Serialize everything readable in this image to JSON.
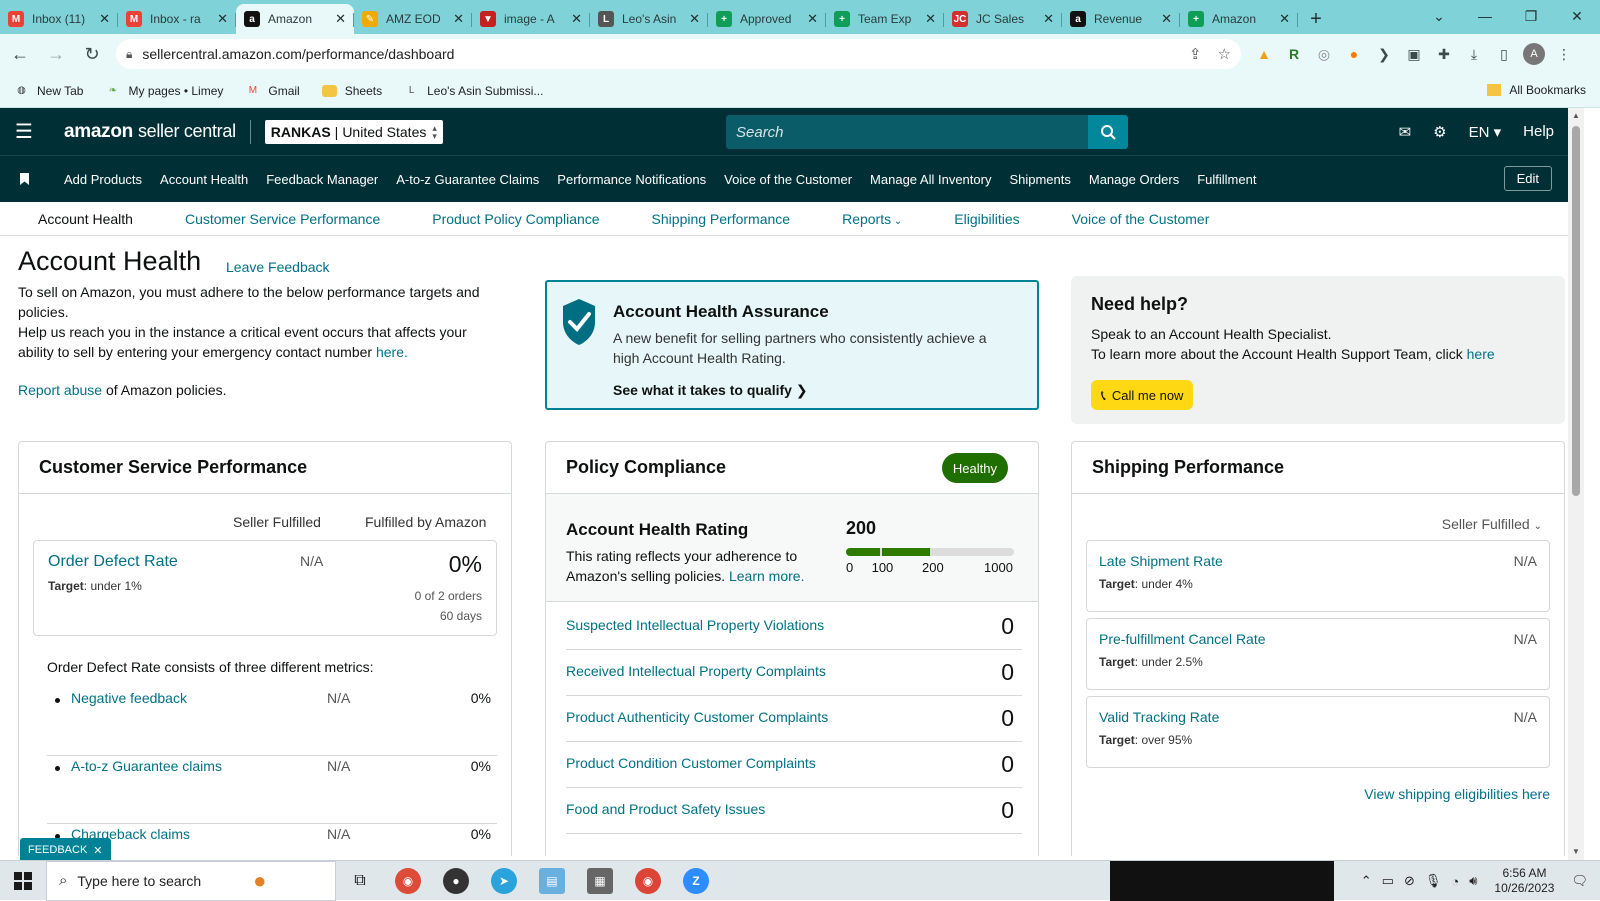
{
  "browser": {
    "tabs": [
      {
        "title": "Inbox (11)",
        "icon": "gmail-icon",
        "color": "#ea4335",
        "glyph": "M"
      },
      {
        "title": "Inbox - ra",
        "icon": "gmail-icon",
        "color": "#ea4335",
        "glyph": "M"
      },
      {
        "title": "Amazon",
        "icon": "amazon-icon",
        "color": "#111111",
        "glyph": "a"
      },
      {
        "title": "AMZ EOD",
        "icon": "pencil-icon",
        "color": "#f2a900",
        "glyph": "✎"
      },
      {
        "title": "image - A",
        "icon": "gmail-icon",
        "color": "#c5221f",
        "glyph": "▼"
      },
      {
        "title": "Leo's Asin",
        "icon": "form-icon",
        "color": "#555555",
        "glyph": "L"
      },
      {
        "title": "Approved",
        "icon": "sheets-icon",
        "color": "#0f9d58",
        "glyph": "+"
      },
      {
        "title": "Team Exp",
        "icon": "sheets-icon",
        "color": "#0f9d58",
        "glyph": "+"
      },
      {
        "title": "JC Sales",
        "icon": "jc-icon",
        "color": "#d32f2f",
        "glyph": "JC"
      },
      {
        "title": "Revenue",
        "icon": "amazon-icon",
        "color": "#111111",
        "glyph": "a"
      },
      {
        "title": "Amazon",
        "icon": "sheets-icon",
        "color": "#0f9d58",
        "glyph": "+"
      }
    ],
    "active_tab": 2,
    "url": "sellercentral.amazon.com/performance/dashboard",
    "bookmarks": [
      {
        "label": "New Tab",
        "icon": "globe-icon"
      },
      {
        "label": "My pages • Limey",
        "icon": "leaf-icon"
      },
      {
        "label": "Gmail",
        "icon": "gmail-icon"
      },
      {
        "label": "Sheets",
        "icon": "folder-icon"
      },
      {
        "label": "Leo's Asin Submissi...",
        "icon": "form-icon"
      }
    ],
    "all_bookmarks": "All Bookmarks",
    "profile_initial": "A"
  },
  "header": {
    "logo_amazon": "amazon",
    "logo_sc": "seller central",
    "store_name": "RANKAS",
    "store_region": "United States",
    "search_placeholder": "Search",
    "language": "EN",
    "help": "Help"
  },
  "nav": {
    "items": [
      "Add Products",
      "Account Health",
      "Feedback Manager",
      "A-to-z Guarantee Claims",
      "Performance Notifications",
      "Voice of the Customer",
      "Manage All Inventory",
      "Shipments",
      "Manage Orders",
      "Fulfillment"
    ],
    "edit": "Edit"
  },
  "subnav": {
    "items": [
      "Account Health",
      "Customer Service Performance",
      "Product Policy Compliance",
      "Shipping Performance",
      "Reports",
      "Eligibilities",
      "Voice of the Customer"
    ]
  },
  "page": {
    "title": "Account Health",
    "leave_feedback": "Leave Feedback",
    "intro1": "To sell on Amazon, you must adhere to the below performance targets and policies.",
    "intro2": "Help us reach you in the instance a critical event occurs that affects your ability to sell by entering your emergency contact number",
    "intro2_link": "here.",
    "report_link": "Report abuse",
    "report_rest": "of Amazon policies."
  },
  "aha": {
    "title": "Account Health Assurance",
    "desc": "A new benefit for selling partners who consistently achieve a high Account Health Rating.",
    "cta": "See what it takes to qualify"
  },
  "help_box": {
    "title": "Need help?",
    "line1": "Speak to an Account Health Specialist.",
    "line2": "To learn more about the Account Health Support Team, click",
    "line2_link": "here",
    "button": "Call me now"
  },
  "csp": {
    "title": "Customer Service Performance",
    "col_sf": "Seller Fulfilled",
    "col_fba": "Fulfilled by Amazon",
    "odr_label": "Order Defect Rate",
    "odr_target_label": "Target",
    "odr_target": ": under 1%",
    "odr_sf": "N/A",
    "odr_fba": "0%",
    "odr_orders": "0 of 2 orders",
    "odr_days": "60 days",
    "desc": "Order Defect Rate consists of three different metrics:",
    "metrics": [
      {
        "label": "Negative feedback",
        "sf": "N/A",
        "fba": "0%"
      },
      {
        "label": "A-to-z Guarantee claims",
        "sf": "N/A",
        "fba": "0%"
      },
      {
        "label": "Chargeback claims",
        "sf": "N/A",
        "fba": "0%"
      }
    ]
  },
  "policy": {
    "title": "Policy Compliance",
    "status": "Healthy",
    "ahr_title": "Account Health Rating",
    "ahr_desc": "This rating reflects your adherence to Amazon's selling policies.",
    "ahr_link": "Learn more.",
    "ahr_score": "200",
    "ahr_score_value": 200,
    "ahr_ticks": [
      "0",
      "100",
      "200",
      "1000"
    ],
    "rows": [
      {
        "label": "Suspected Intellectual Property Violations",
        "value": "0"
      },
      {
        "label": "Received Intellectual Property Complaints",
        "value": "0"
      },
      {
        "label": "Product Authenticity Customer Complaints",
        "value": "0"
      },
      {
        "label": "Product Condition Customer Complaints",
        "value": "0"
      },
      {
        "label": "Food and Product Safety Issues",
        "value": "0"
      }
    ]
  },
  "shipping": {
    "title": "Shipping Performance",
    "filter": "Seller Fulfilled",
    "target_label": "Target",
    "metrics": [
      {
        "label": "Late Shipment Rate",
        "target": ": under 4%",
        "value": "N/A"
      },
      {
        "label": "Pre-fulfillment Cancel Rate",
        "target": ": under 2.5%",
        "value": "N/A"
      },
      {
        "label": "Valid Tracking Rate",
        "target": ": over 95%",
        "value": "N/A"
      }
    ],
    "more": "View shipping eligibilities here"
  },
  "feedback_tab": "FEEDBACK",
  "taskbar": {
    "search_placeholder": "Type here to search",
    "time": "6:56 AM",
    "date": "10/26/2023"
  },
  "colors": {
    "header_bg": "#002f36",
    "link": "#007185",
    "healthy": "#1e6e00",
    "call_btn": "#ffd814",
    "aha_border": "#008296"
  }
}
